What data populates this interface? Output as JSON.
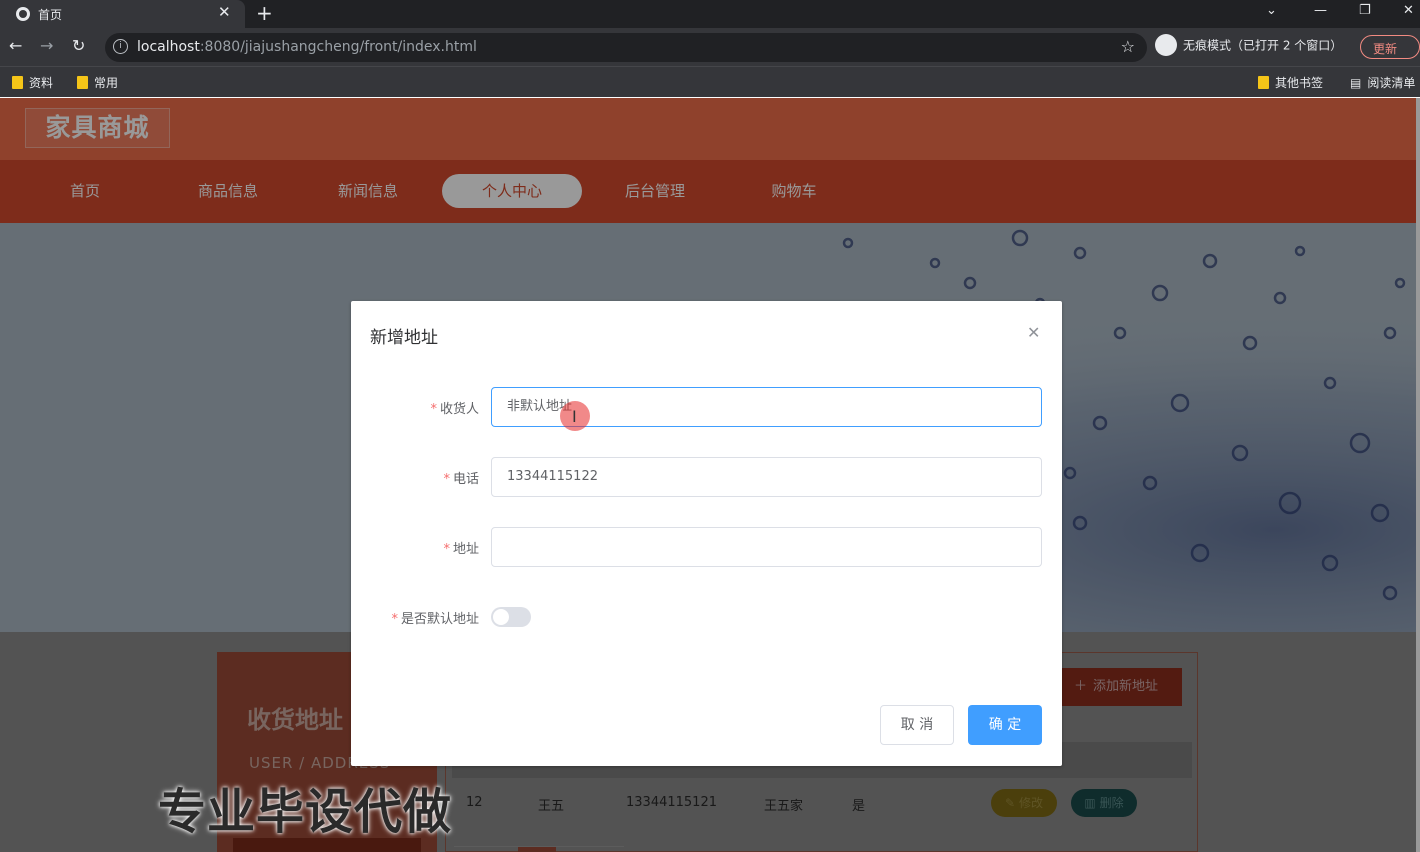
{
  "browser": {
    "tab_title": "首页",
    "tab_close": "✕",
    "new_tab": "+",
    "url_host": "localhost",
    "url_path": ":8080/jiajushangcheng/front/index.html",
    "incognito_label": "无痕模式（已打开 2 个窗口）",
    "update_label": "更新",
    "bookmarks": [
      "资料",
      "常用"
    ],
    "other_bookmarks": "其他书签",
    "reading_list": "阅读清单"
  },
  "site": {
    "logo": "家具商城",
    "nav": [
      {
        "label": "首页",
        "active": false
      },
      {
        "label": "商品信息",
        "active": false
      },
      {
        "label": "新闻信息",
        "active": false
      },
      {
        "label": "个人中心",
        "active": true
      },
      {
        "label": "后台管理",
        "active": false
      },
      {
        "label": "购物车",
        "active": false
      }
    ]
  },
  "page": {
    "side_title": "收货地址",
    "side_subtitle": "USER / ADDRESS",
    "add_button": "添加新地址",
    "row": {
      "id": "12",
      "name": "王五",
      "phone": "13344115121",
      "address": "王五家",
      "is_default": "是"
    },
    "edit_button": "修改",
    "delete_button": "删除"
  },
  "dialog": {
    "title": "新增地址",
    "fields": {
      "receiver": {
        "label": "收货人",
        "value": "非默认地址"
      },
      "phone": {
        "label": "电话",
        "value": "13344115122"
      },
      "address": {
        "label": "地址",
        "value": ""
      },
      "is_default": {
        "label": "是否默认地址",
        "value": false
      }
    },
    "cancel_button": "取 消",
    "confirm_button": "确 定"
  },
  "watermark": "专业毕设代做",
  "colors": {
    "header": "#ef6d4a",
    "nav": "#d24a2e",
    "primary": "#409eff",
    "required": "#f56c6c"
  }
}
